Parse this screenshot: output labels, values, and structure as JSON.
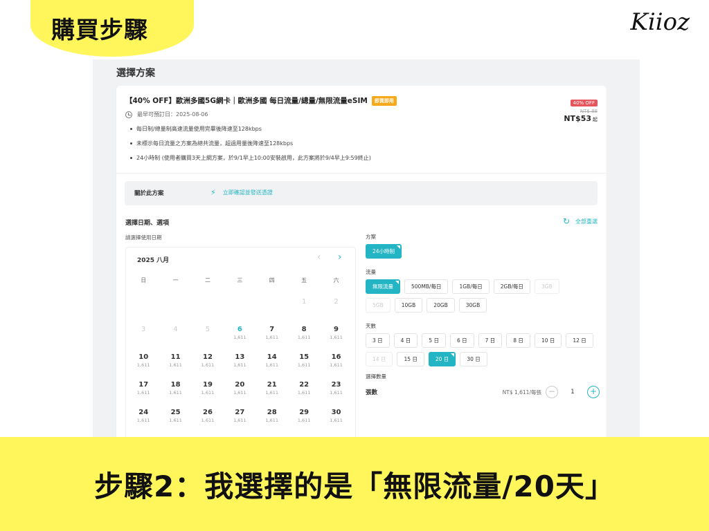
{
  "banner": {
    "badge": "購買步驟",
    "logo": "Kiioz",
    "caption": "步驟2：我選擇的是「無限流量/20天」"
  },
  "section_title": "選擇方案",
  "product": {
    "title": "【40% OFF】歐洲多國5G網卡｜歐洲多國 每日流量/總量/無限流量eSIM",
    "tag": "即買即用",
    "earliest_date": "最早可預訂日：2025-08-06",
    "bullets": [
      "每日制/總量制高速流量使用完畢後降速至128kbps",
      "未標示每日流量之方案為總共流量，超過用量後降速至128kbps",
      "24小時制 (使用者購買3天上網方案，於9/1早上10:00安裝啟用，此方案將於9/4早上9:59終止)"
    ],
    "off_badge": "40% OFF",
    "old_price": "NT$ 88",
    "price": "NT$53",
    "price_suffix": "起"
  },
  "about": {
    "label": "關於此方案",
    "link": "立即確認並發送憑證"
  },
  "selection": {
    "title": "選擇日期、選項",
    "reset": "全部重選",
    "date_prompt": "請選擇使用日期"
  },
  "calendar": {
    "month": "2025 八月",
    "weekdays": [
      "日",
      "一",
      "二",
      "三",
      "四",
      "五",
      "六"
    ],
    "weeks": [
      [
        {
          "d": "",
          "p": ""
        },
        {
          "d": "",
          "p": ""
        },
        {
          "d": "",
          "p": ""
        },
        {
          "d": "",
          "p": ""
        },
        {
          "d": "",
          "p": ""
        },
        {
          "d": "1",
          "p": ""
        },
        {
          "d": "2",
          "p": ""
        }
      ],
      [
        {
          "d": "3",
          "p": ""
        },
        {
          "d": "4",
          "p": ""
        },
        {
          "d": "5",
          "p": ""
        },
        {
          "d": "6",
          "p": "1,611"
        },
        {
          "d": "7",
          "p": "1,611"
        },
        {
          "d": "8",
          "p": "1,611"
        },
        {
          "d": "9",
          "p": "1,611"
        }
      ],
      [
        {
          "d": "10",
          "p": "1,611"
        },
        {
          "d": "11",
          "p": "1,611"
        },
        {
          "d": "12",
          "p": "1,611"
        },
        {
          "d": "13",
          "p": "1,611"
        },
        {
          "d": "14",
          "p": "1,611"
        },
        {
          "d": "15",
          "p": "1,611"
        },
        {
          "d": "16",
          "p": "1,611"
        }
      ],
      [
        {
          "d": "17",
          "p": "1,611"
        },
        {
          "d": "18",
          "p": "1,611"
        },
        {
          "d": "19",
          "p": "1,611"
        },
        {
          "d": "20",
          "p": "1,611"
        },
        {
          "d": "21",
          "p": "1,611"
        },
        {
          "d": "22",
          "p": "1,611"
        },
        {
          "d": "23",
          "p": "1,611"
        }
      ],
      [
        {
          "d": "24",
          "p": "1,611"
        },
        {
          "d": "25",
          "p": "1,611"
        },
        {
          "d": "26",
          "p": "1,611"
        },
        {
          "d": "27",
          "p": "1,611"
        },
        {
          "d": "28",
          "p": "1,611"
        },
        {
          "d": "29",
          "p": "1,611"
        },
        {
          "d": "30",
          "p": "1,611"
        }
      ]
    ]
  },
  "options": {
    "plan": {
      "label": "方案",
      "chips": [
        {
          "text": "24小時制",
          "state": "selected"
        }
      ]
    },
    "data": {
      "label": "流量",
      "chips": [
        {
          "text": "無限流量",
          "state": "selected"
        },
        {
          "text": "500MB/每日",
          "state": "normal"
        },
        {
          "text": "1GB/每日",
          "state": "normal"
        },
        {
          "text": "2GB/每日",
          "state": "normal"
        },
        {
          "text": "3GB",
          "state": "disabled"
        },
        {
          "text": "5GB",
          "state": "disabled"
        },
        {
          "text": "10GB",
          "state": "normal"
        },
        {
          "text": "20GB",
          "state": "normal"
        },
        {
          "text": "30GB",
          "state": "normal"
        }
      ]
    },
    "days": {
      "label": "天數",
      "chips": [
        {
          "text": "3 日",
          "state": "normal"
        },
        {
          "text": "4 日",
          "state": "normal"
        },
        {
          "text": "5 日",
          "state": "normal"
        },
        {
          "text": "6 日",
          "state": "normal"
        },
        {
          "text": "7 日",
          "state": "normal"
        },
        {
          "text": "8 日",
          "state": "normal"
        },
        {
          "text": "10 日",
          "state": "normal"
        },
        {
          "text": "12 日",
          "state": "normal"
        },
        {
          "text": "14 日",
          "state": "disabled"
        },
        {
          "text": "15 日",
          "state": "normal"
        },
        {
          "text": "20 日",
          "state": "selected"
        },
        {
          "text": "30 日",
          "state": "normal"
        }
      ]
    }
  },
  "quantity": {
    "label": "選擇數量",
    "name": "張數",
    "unit_price": "NT$ 1,611/每張",
    "minus": "−",
    "value": "1",
    "plus": "+"
  }
}
